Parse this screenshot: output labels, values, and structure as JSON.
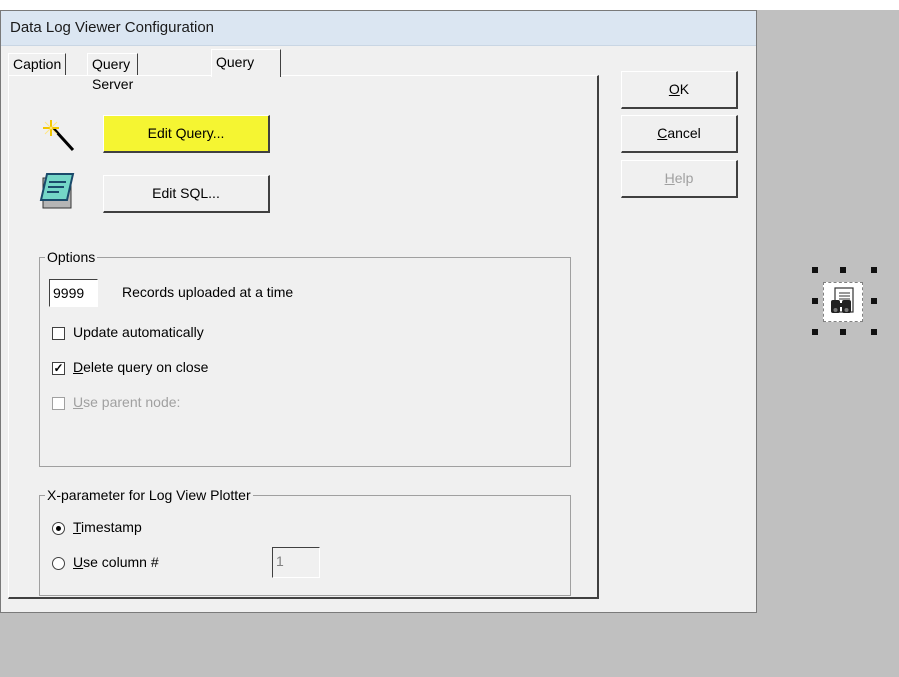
{
  "window": {
    "title": "Data Log Viewer Configuration"
  },
  "tabs": [
    {
      "label": "Caption",
      "active": false
    },
    {
      "label": "Query Server",
      "active": false
    },
    {
      "label": "Query",
      "active": true
    }
  ],
  "buttons": {
    "ok": {
      "label": "OK",
      "mnemonic": "O",
      "rest": "K"
    },
    "cancel": {
      "label": "Cancel",
      "mnemonic": "C",
      "rest": "ancel"
    },
    "help": {
      "label": "Help",
      "mnemonic": "H",
      "rest": "elp",
      "enabled": false
    }
  },
  "query_panel": {
    "edit_query": {
      "label": "Edit Query...",
      "icon": "magic-wand-icon",
      "highlight_color": "#f5f532"
    },
    "edit_sql": {
      "label": "Edit SQL...",
      "icon": "notepad-icon"
    }
  },
  "options": {
    "legend": "Options",
    "records_value": "9999",
    "records_label": "Records uploaded at a time",
    "update_auto": {
      "label": "Update automatically",
      "checked": false
    },
    "delete_query": {
      "label": "Delete query on close",
      "mnemonic": "D",
      "rest": "elete query on close",
      "checked": true
    },
    "use_parent": {
      "label": "Use parent node:",
      "mnemonic": "U",
      "rest": "se parent node:",
      "checked": false,
      "enabled": false
    }
  },
  "xparam": {
    "legend": "X-parameter for Log View Plotter",
    "timestamp": {
      "label": "Timestamp",
      "mnemonic": "T",
      "rest": "imestamp",
      "selected": true
    },
    "use_column": {
      "label": "Use column #",
      "mnemonic": "U",
      "rest": "se column #",
      "selected": false
    },
    "column_value": "1"
  },
  "canvas": {
    "selected_object_icon": "binoculars-report-icon"
  }
}
